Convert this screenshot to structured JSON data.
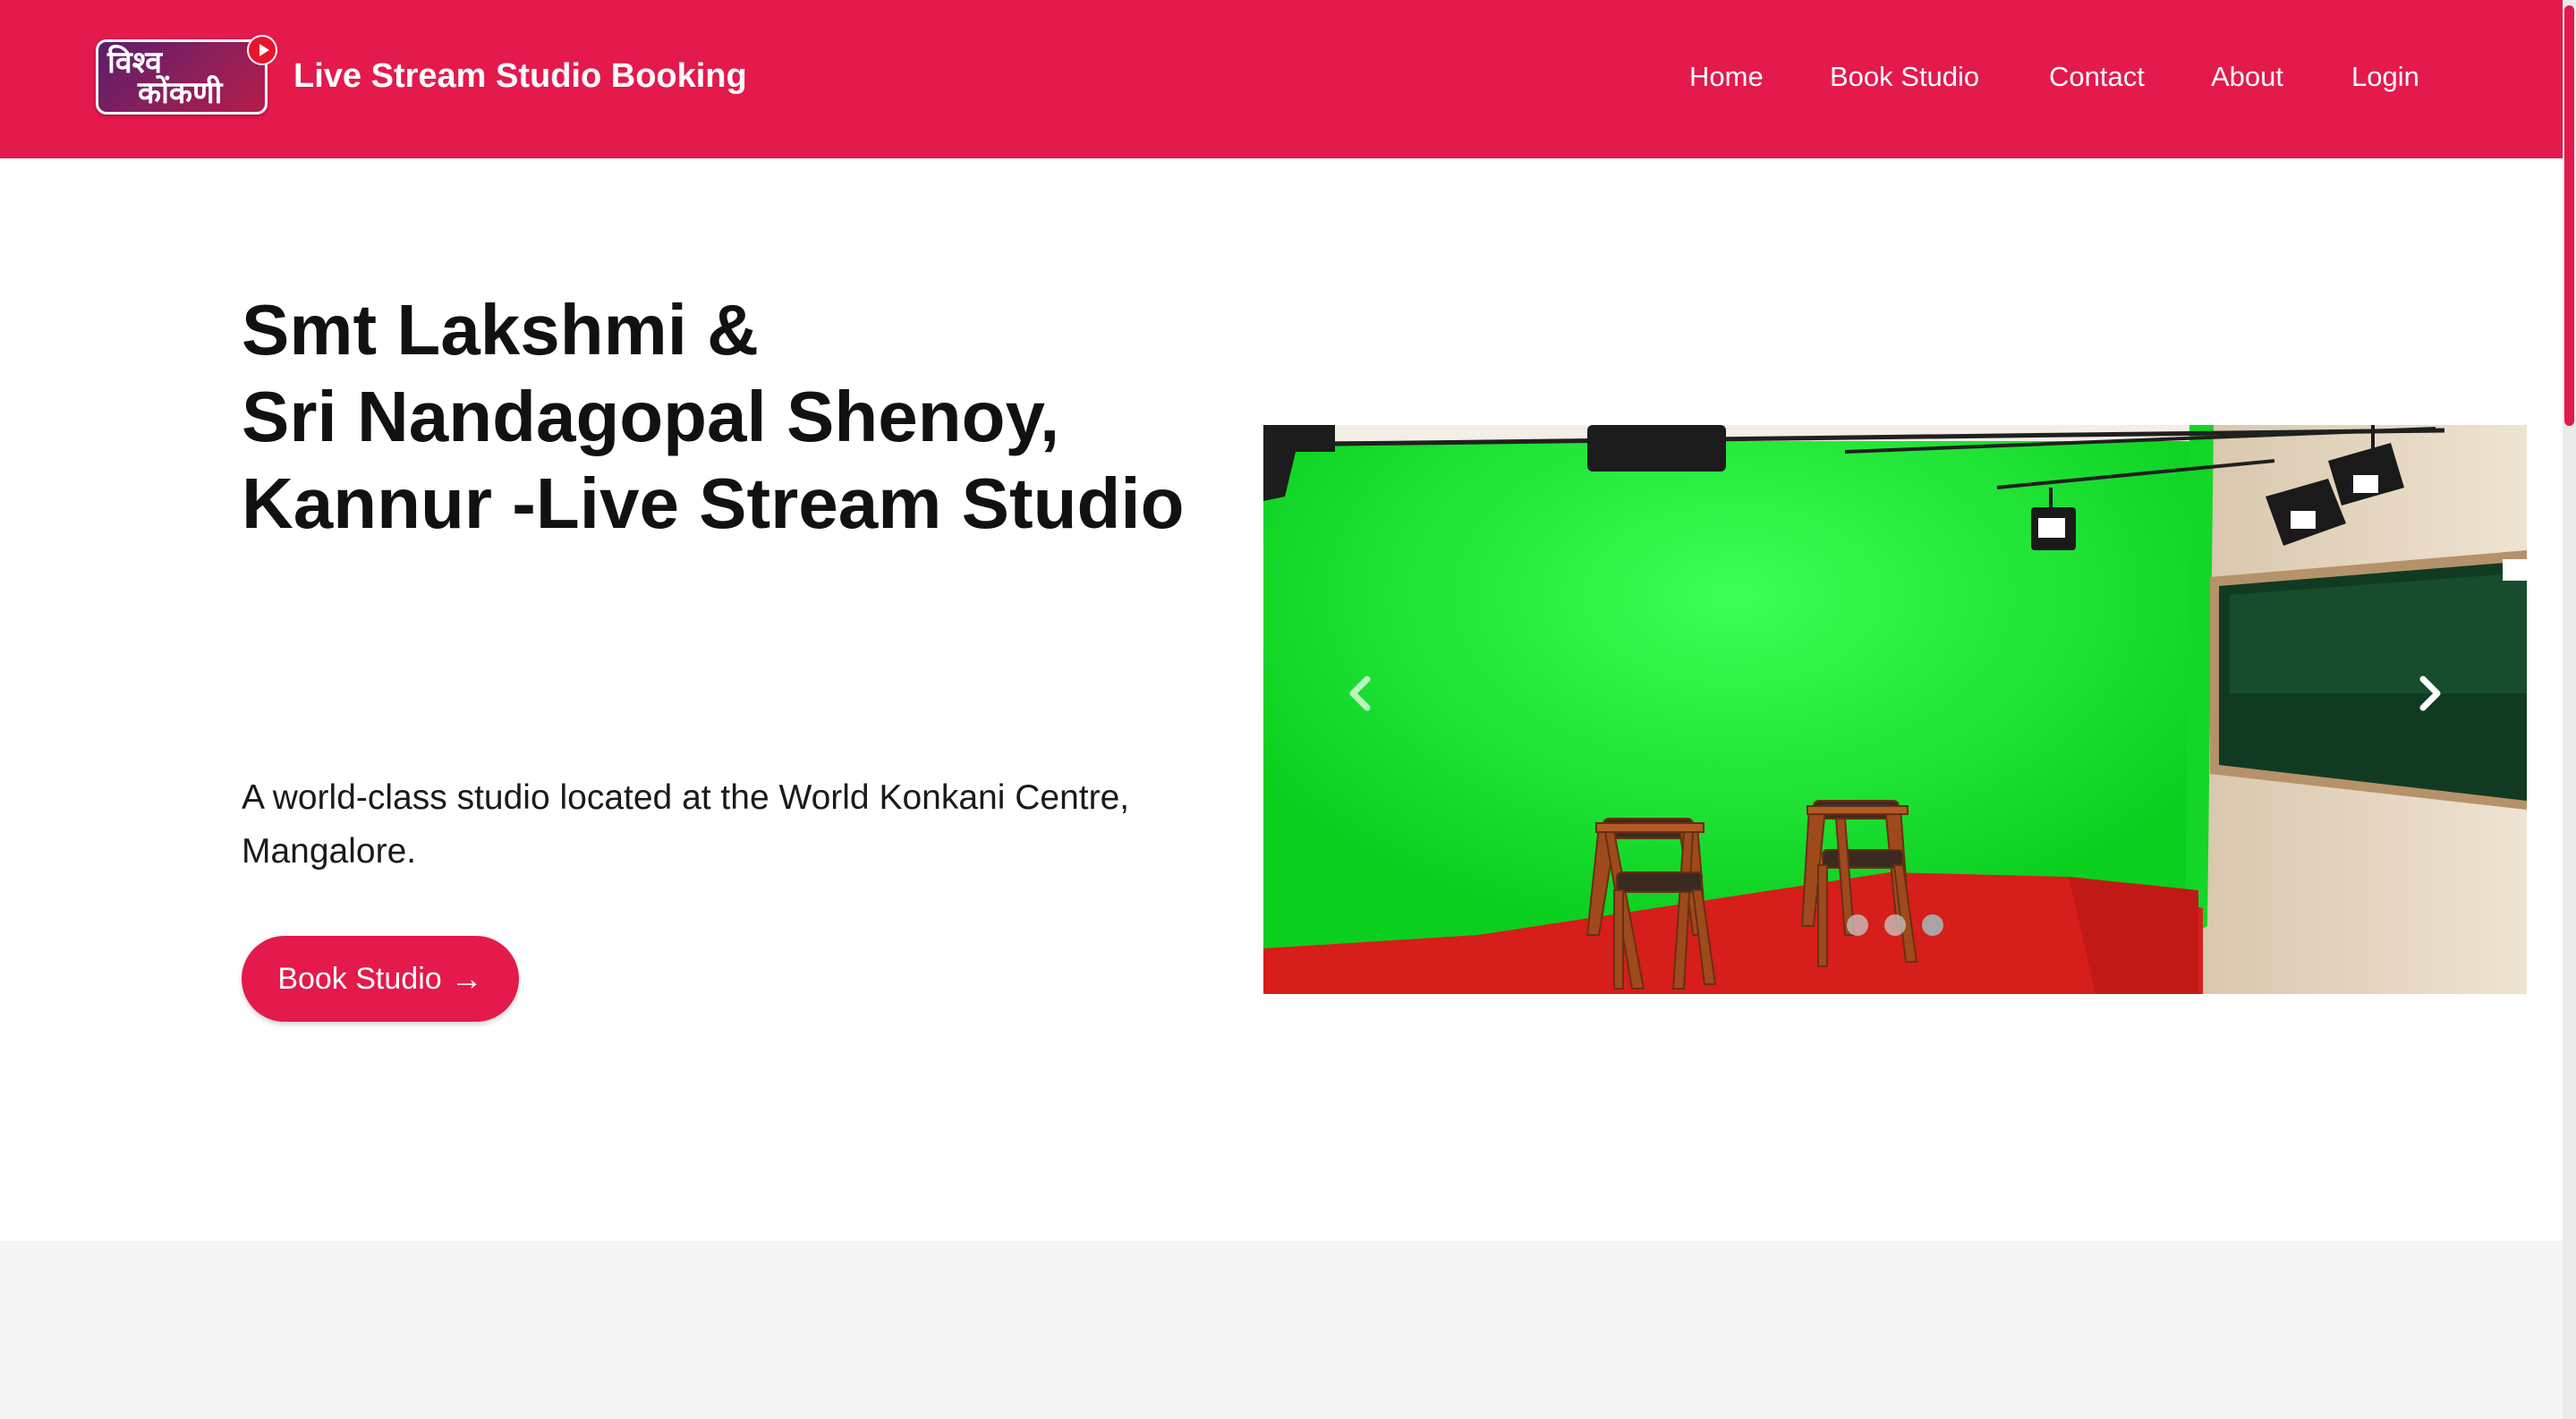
{
  "header": {
    "logo_line1": "विश्व",
    "logo_line2": "कोंकणी",
    "title": "Live Stream Studio Booking",
    "nav": [
      {
        "label": "Home"
      },
      {
        "label": "Book Studio"
      },
      {
        "label": "Contact"
      },
      {
        "label": "About"
      },
      {
        "label": "Login"
      }
    ]
  },
  "hero": {
    "title": "Smt Lakshmi &\nSri Nandagopal Shenoy,\nKannur -Live Stream Studio",
    "description": "A world-class studio located at the World Konkani Centre, Mangalore.",
    "button_label": "Book Studio",
    "button_icon": "→"
  },
  "carousel": {
    "slide_count": 3,
    "active_slide": 3,
    "prev_icon": "chevron-left-icon",
    "next_icon": "chevron-right-icon"
  },
  "colors": {
    "brand": "#e4194c",
    "green_screen": "#0fd824",
    "floor": "#d61e1a"
  }
}
